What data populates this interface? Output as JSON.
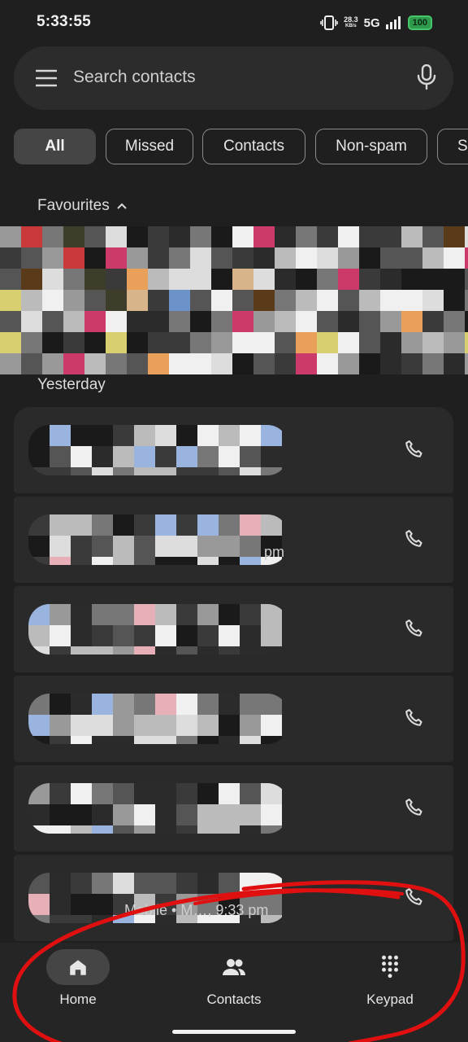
{
  "status_bar": {
    "time": "5:33:55",
    "speed_value": "28.3",
    "speed_unit": "KB/s",
    "network": "5G",
    "battery": "100"
  },
  "search": {
    "placeholder": "Search contacts"
  },
  "chips": [
    {
      "label": "All",
      "active": true
    },
    {
      "label": "Missed"
    },
    {
      "label": "Contacts"
    },
    {
      "label": "Non-spam"
    },
    {
      "label": "Sp"
    }
  ],
  "favourites": {
    "title": "Favourites"
  },
  "call_log": {
    "section_title": "Yesterday",
    "visible_fragments": [
      "pm",
      "Mobile • M…, 9:33 pm"
    ]
  },
  "bottom_nav": {
    "items": [
      {
        "label": "Home",
        "active": true,
        "icon": "home-icon"
      },
      {
        "label": "Contacts",
        "icon": "people-icon"
      },
      {
        "label": "Keypad",
        "icon": "dialpad-icon"
      }
    ]
  },
  "colors": {
    "background": "#1f1f1f",
    "card": "#2a2a2a",
    "annotation": "#e01010",
    "battery": "#2e9b4c"
  }
}
